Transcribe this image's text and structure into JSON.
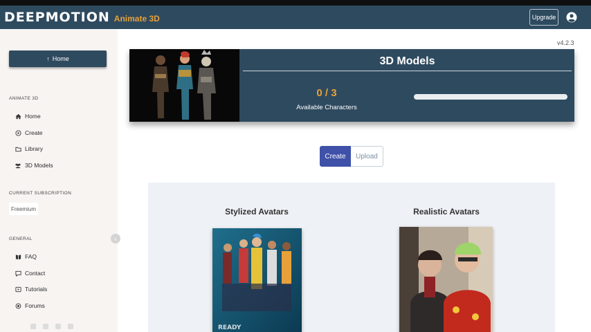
{
  "header": {
    "logo_main": "DEEPMOTION",
    "logo_sub": "Animate 3D",
    "upgrade_label": "Upgrade",
    "accent_color": "#e8a13a",
    "bar_color": "#2e4a5f"
  },
  "sidebar": {
    "home_button_label": "Home",
    "animate_section_label": "ANIMATE 3D",
    "animate_items": [
      {
        "label": "Home",
        "icon": "home-icon"
      },
      {
        "label": "Create",
        "icon": "create-icon"
      },
      {
        "label": "Library",
        "icon": "folder-icon"
      },
      {
        "label": "3D Models",
        "icon": "users-icon"
      }
    ],
    "subscription_label": "CURRENT SUBSCRIPTION",
    "subscription_value": "Freemium",
    "general_label": "GENERAL",
    "general_items": [
      {
        "label": "FAQ",
        "icon": "book-icon"
      },
      {
        "label": "Contact",
        "icon": "chat-icon"
      },
      {
        "label": "Tutorials",
        "icon": "video-icon"
      },
      {
        "label": "Forums",
        "icon": "forum-icon"
      }
    ]
  },
  "main": {
    "version": "v4.2.3",
    "models_card": {
      "title": "3D Models",
      "count": "0 / 3",
      "count_caption": "Available Characters",
      "progress_fraction": 0
    },
    "toggle": {
      "create_label": "Create",
      "upload_label": "Upload",
      "selected": "Create"
    },
    "avatars": {
      "stylized_title": "Stylized Avatars",
      "realistic_title": "Realistic Avatars"
    }
  }
}
